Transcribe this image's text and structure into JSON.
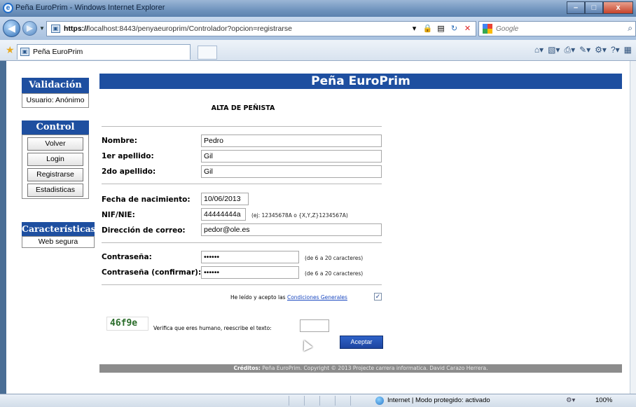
{
  "window": {
    "title": "Peña EuroPrim - Windows Internet Explorer",
    "buttons": {
      "minimize": "–",
      "maximize": "□",
      "close": "x"
    }
  },
  "address_bar": {
    "url_bold": "https://",
    "url_rest": "localhost:8443/penyaeuroprim/Controlador?opcion=registrarse",
    "search_placeholder": "Google"
  },
  "tabs": [
    {
      "label": "Peña EuroPrim"
    }
  ],
  "sidebar": {
    "validacion": {
      "title": "Validación",
      "user": "Usuario: Anónimo"
    },
    "control": {
      "title": "Control",
      "buttons": [
        "Volver",
        "Login",
        "Registrarse",
        "Estadisticas"
      ]
    },
    "caracteristicas": {
      "title": "Características",
      "item": "Web segura"
    }
  },
  "page": {
    "header": "Peña EuroPrim",
    "subtitle": "ALTA DE PEÑISTA"
  },
  "form": {
    "nombre": {
      "label": "Nombre:",
      "value": "Pedro"
    },
    "apellido1": {
      "label": "1er apellido:",
      "value": "Gil"
    },
    "apellido2": {
      "label": "2do apellido:",
      "value": "Gil"
    },
    "fecha": {
      "label": "Fecha de nacimiento:",
      "value": "10/06/2013"
    },
    "nif": {
      "label": "NIF/NIE:",
      "value": "44444444a",
      "hint": "(ej: 12345678A o {X,Y,Z}1234567A)"
    },
    "correo": {
      "label": "Dirección de correo:",
      "value": "pedor@ole.es"
    },
    "password": {
      "label": "Contraseña:",
      "value": "••••••",
      "hint": "(de 6 a 20 caracteres)"
    },
    "password_confirm": {
      "label": "Contraseña (confirmar):",
      "value": "••••••",
      "hint": "(de 6 a 20 caracteres)"
    },
    "terms_text": "He leído y acepto las",
    "terms_link": "Condiciones Generales",
    "terms_checked": true,
    "captcha_code": "46f9e",
    "captcha_prompt": "Verifica que eres humano, reescribe el texto:",
    "captcha_value": "",
    "submit_label": "Aceptar"
  },
  "footer": {
    "prefix": "Créditos:",
    "text": "Peña EuroPrim. Copyright © 2013 Projecte carrera informatica. David Carazo Herrera."
  },
  "status_bar": {
    "zone": "Internet | Modo protegido: activado",
    "zoom": "100%"
  },
  "colors": {
    "header_bg": "#1e4fa0",
    "footer_bg": "#8c8c8c",
    "captcha": "#2a6c2a"
  }
}
